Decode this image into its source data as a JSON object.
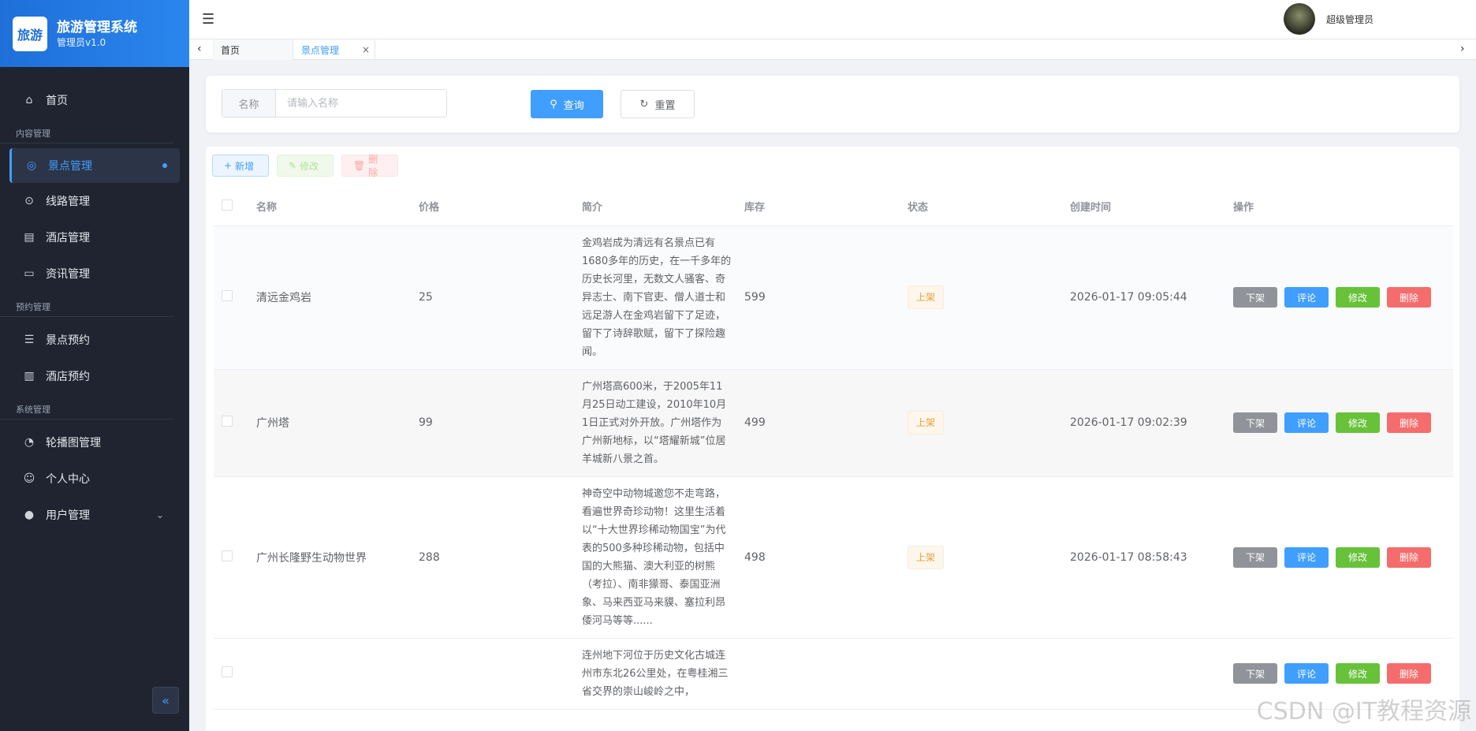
{
  "app": {
    "logo_text": "旅游",
    "title": "旅游管理系统",
    "subtitle": "管理员v1.0"
  },
  "sidebar": {
    "items": [
      {
        "label": "首页"
      },
      {
        "group": "内容管理"
      },
      {
        "label": "景点管理"
      },
      {
        "label": "线路管理"
      },
      {
        "label": "酒店管理"
      },
      {
        "label": "资讯管理"
      },
      {
        "group": "预约管理"
      },
      {
        "label": "景点预约"
      },
      {
        "label": "酒店预约"
      },
      {
        "group": "系统管理"
      },
      {
        "label": "轮播图管理"
      },
      {
        "label": "个人中心"
      },
      {
        "label": "用户管理"
      }
    ]
  },
  "header": {
    "user_name": "超级管理员"
  },
  "tabs": [
    {
      "label": "首页"
    },
    {
      "label": "景点管理"
    }
  ],
  "search": {
    "label": "名称",
    "placeholder": "请输入名称",
    "query_label": "查询",
    "reset_label": "重置"
  },
  "toolbar": {
    "add_label": "新增",
    "edit_label": "修改",
    "delete_label": "删除"
  },
  "table": {
    "columns": [
      "名称",
      "价格",
      "简介",
      "库存",
      "状态",
      "创建时间",
      "操作"
    ],
    "rows": [
      {
        "name": "清远金鸡岩",
        "price": "25",
        "desc": "金鸡岩成为清远有名景点已有1680多年的历史，在一千多年的历史长河里，无数文人骚客、奇异志士、南下官吏、僧人道士和远足游人在金鸡岩留下了足迹，留下了诗辞歌赋，留下了探险趣闻。",
        "stock": "599",
        "status": "上架",
        "created": "2026-01-17 09:05:44"
      },
      {
        "name": "广州塔",
        "price": "99",
        "desc": "广州塔高600米，于2005年11月25日动工建设，2010年10月1日正式对外开放。广州塔作为广州新地标，以“塔耀新城”位居羊城新八景之首。",
        "stock": "499",
        "status": "上架",
        "created": "2026-01-17 09:02:39"
      },
      {
        "name": "广州长隆野生动物世界",
        "price": "288",
        "desc": "神奇空中动物城邀您不走弯路，看遍世界奇珍动物！这里生活着以“十大世界珍稀动物国宝”为代表的500多种珍稀动物，包括中国的大熊猫、澳大利亚的树熊（考拉）、南非獴哥、泰国亚洲象、马来西亚马来貘、塞拉利昂倭河马等等......",
        "stock": "498",
        "status": "上架",
        "created": "2026-01-17 08:58:43"
      },
      {
        "name": "",
        "price": "",
        "desc": "连州地下河位于历史文化古城连州市东北26公里处，在粤桂湘三省交界的崇山峻岭之中，",
        "stock": "",
        "status": "",
        "created": ""
      }
    ],
    "ops": {
      "off": "下架",
      "comment": "评论",
      "modify": "修改",
      "remove": "删除"
    }
  },
  "watermark": "CSDN @IT教程资源"
}
